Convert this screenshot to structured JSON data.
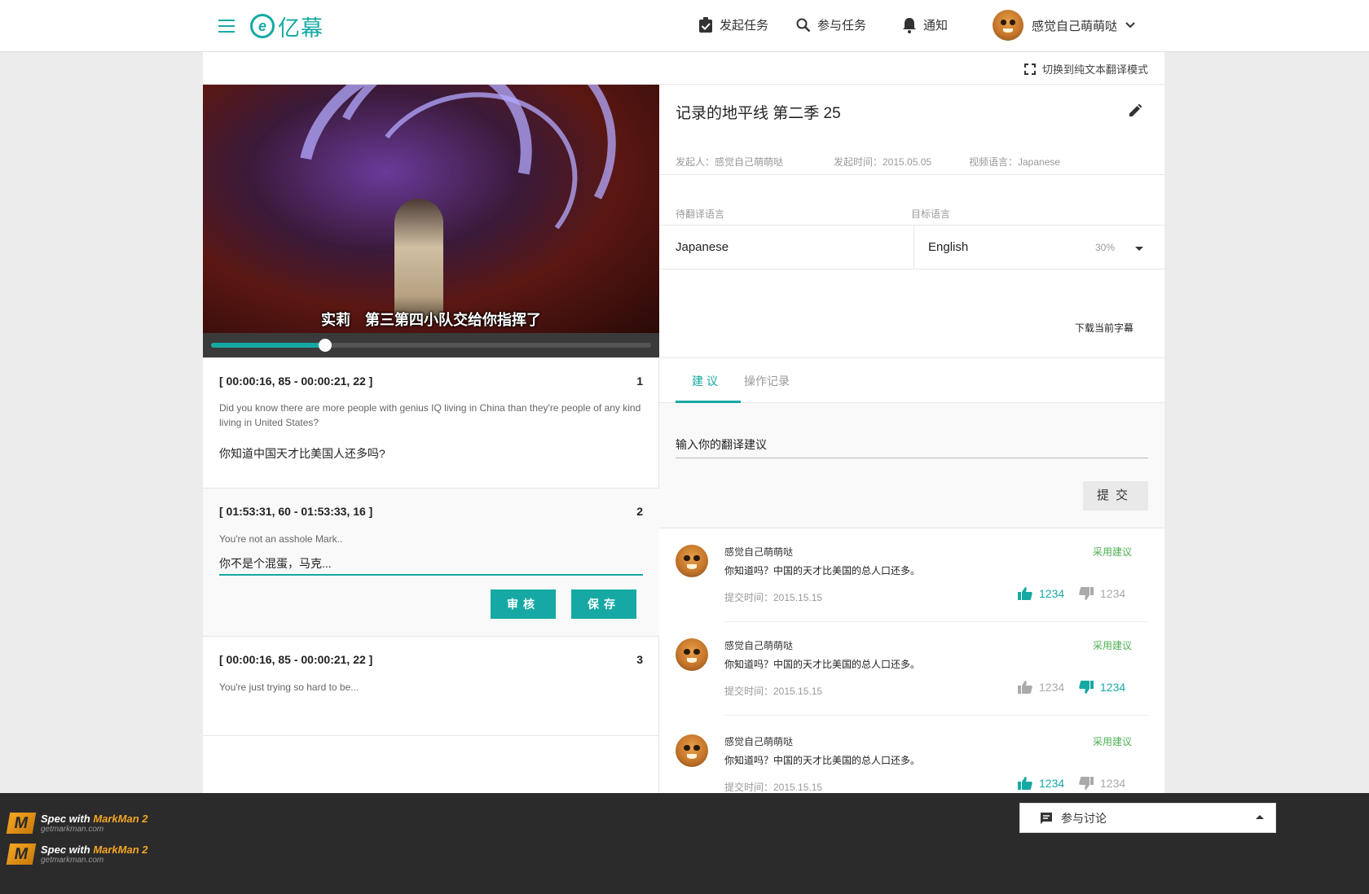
{
  "header": {
    "logo_text": "亿幕",
    "nav": {
      "publish": "发起任务",
      "join": "参与任务",
      "notify": "通知"
    },
    "username": "感觉自己萌萌哒"
  },
  "mode_switch": "切换到纯文本翻译模式",
  "video": {
    "subtitle": "实莉　第三第四小队交给你指挥了",
    "progress": 0.26
  },
  "task": {
    "title": "记录的地平线 第二季 25",
    "initiator": "发起人：感觉自己萌萌哒",
    "date": "发起时间：2015.05.05",
    "video_lang": "视频语言：Japanese",
    "source_lang_label": "待翻译语言",
    "target_lang_label": "目标语言",
    "source_lang": "Japanese",
    "target_lang": "English",
    "target_progress": "30%",
    "download": "下载当前字幕"
  },
  "subtitles": [
    {
      "time": "[ 00:00:16, 85 - 00:00:21, 22 ]",
      "num": "1",
      "source": "Did you know there are more people with genius IQ living in China than they're people of any kind living in United States?",
      "translation": "你知道中国天才比美国人还多吗?"
    },
    {
      "time": "[ 01:53:31, 60 - 01:53:33, 16 ]",
      "num": "2",
      "source": "You're not an asshole Mark..",
      "translation": "你不是个混蛋，马克..."
    },
    {
      "time": "[ 00:00:16, 85 - 00:00:21, 22 ]",
      "num": "3",
      "source": "You're just trying so hard to be..."
    }
  ],
  "buttons": {
    "review": "审核",
    "save": "保存"
  },
  "tabs": {
    "suggest": "建议",
    "history": "操作记录"
  },
  "suggest_placeholder": "输入你的翻译建议",
  "submit_label": "提交",
  "suggestions": [
    {
      "user": "感觉自己萌萌哒",
      "text": "你知道吗？中国的天才比美国的总人口还多。",
      "time": "提交时间：2015.15.15",
      "adopt": "采用建议",
      "likes": "1234",
      "dislikes": "1234",
      "active": "like"
    },
    {
      "user": "感觉自己萌萌哒",
      "text": "你知道吗？中国的天才比美国的总人口还多。",
      "time": "提交时间：2015.15.15",
      "adopt": "采用建议",
      "likes": "1234",
      "dislikes": "1234",
      "active": "dislike"
    },
    {
      "user": "感觉自己萌萌哒",
      "text": "你知道吗？中国的天才比美国的总人口还多。",
      "time": "提交时间：2015.15.15",
      "adopt": "采用建议",
      "likes": "1234",
      "dislikes": "1234",
      "active": "like"
    }
  ],
  "discuss": "参与讨论",
  "footer": {
    "badge_prefix": "Spec with",
    "badge_brand": "MarkMan 2",
    "badge_url": "getmarkman.com"
  },
  "colors": {
    "accent": "#16a9a4",
    "adopt": "#4caf50",
    "muted": "#999999",
    "panel_bg": "#f9f9f9"
  },
  "icons": [
    "menu-icon",
    "logo-icon",
    "assignment-check-icon",
    "search-icon",
    "bell-icon",
    "chevron-down-icon",
    "fullscreen-icon",
    "pencil-icon",
    "thumb-up-icon",
    "thumb-down-icon",
    "comment-icon"
  ]
}
